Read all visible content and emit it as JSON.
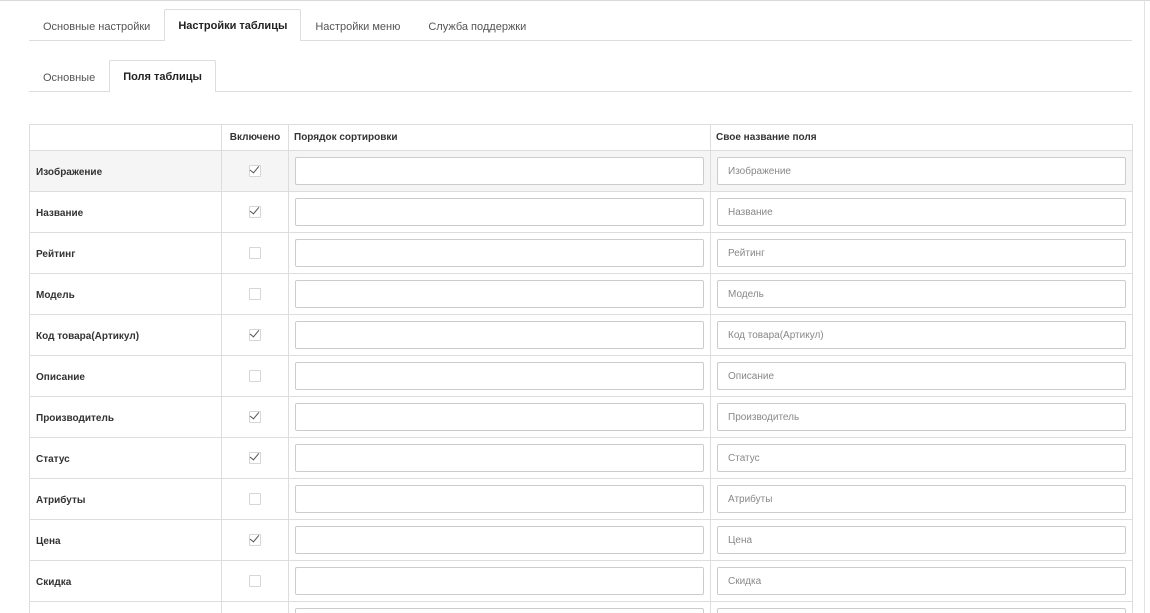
{
  "main_tabs": [
    {
      "label": "Основные настройки",
      "active": false
    },
    {
      "label": "Настройки таблицы",
      "active": true
    },
    {
      "label": "Настройки меню",
      "active": false
    },
    {
      "label": "Служба поддержки",
      "active": false
    }
  ],
  "sub_tabs": [
    {
      "label": "Основные",
      "active": false
    },
    {
      "label": "Поля таблицы",
      "active": true
    }
  ],
  "table": {
    "headers": {
      "field": "",
      "enabled": "Включено",
      "sort_order": "Порядок сортировки",
      "custom_name": "Свое название поля"
    },
    "rows": [
      {
        "name": "Изображение",
        "enabled": true,
        "sort_order": "",
        "custom_name_placeholder": "Изображение"
      },
      {
        "name": "Название",
        "enabled": true,
        "sort_order": "",
        "custom_name_placeholder": "Название"
      },
      {
        "name": "Рейтинг",
        "enabled": false,
        "sort_order": "",
        "custom_name_placeholder": "Рейтинг"
      },
      {
        "name": "Модель",
        "enabled": false,
        "sort_order": "",
        "custom_name_placeholder": "Модель"
      },
      {
        "name": "Код товара(Артикул)",
        "enabled": true,
        "sort_order": "",
        "custom_name_placeholder": "Код товара(Артикул)"
      },
      {
        "name": "Описание",
        "enabled": false,
        "sort_order": "",
        "custom_name_placeholder": "Описание"
      },
      {
        "name": "Производитель",
        "enabled": true,
        "sort_order": "",
        "custom_name_placeholder": "Производитель"
      },
      {
        "name": "Статус",
        "enabled": true,
        "sort_order": "",
        "custom_name_placeholder": "Статус"
      },
      {
        "name": "Атрибуты",
        "enabled": false,
        "sort_order": "",
        "custom_name_placeholder": "Атрибуты"
      },
      {
        "name": "Цена",
        "enabled": true,
        "sort_order": "",
        "custom_name_placeholder": "Цена"
      },
      {
        "name": "Скидка",
        "enabled": false,
        "sort_order": "",
        "custom_name_placeholder": "Скидка"
      },
      {
        "name": "",
        "enabled": false,
        "sort_order": "",
        "custom_name_placeholder": ""
      }
    ]
  }
}
